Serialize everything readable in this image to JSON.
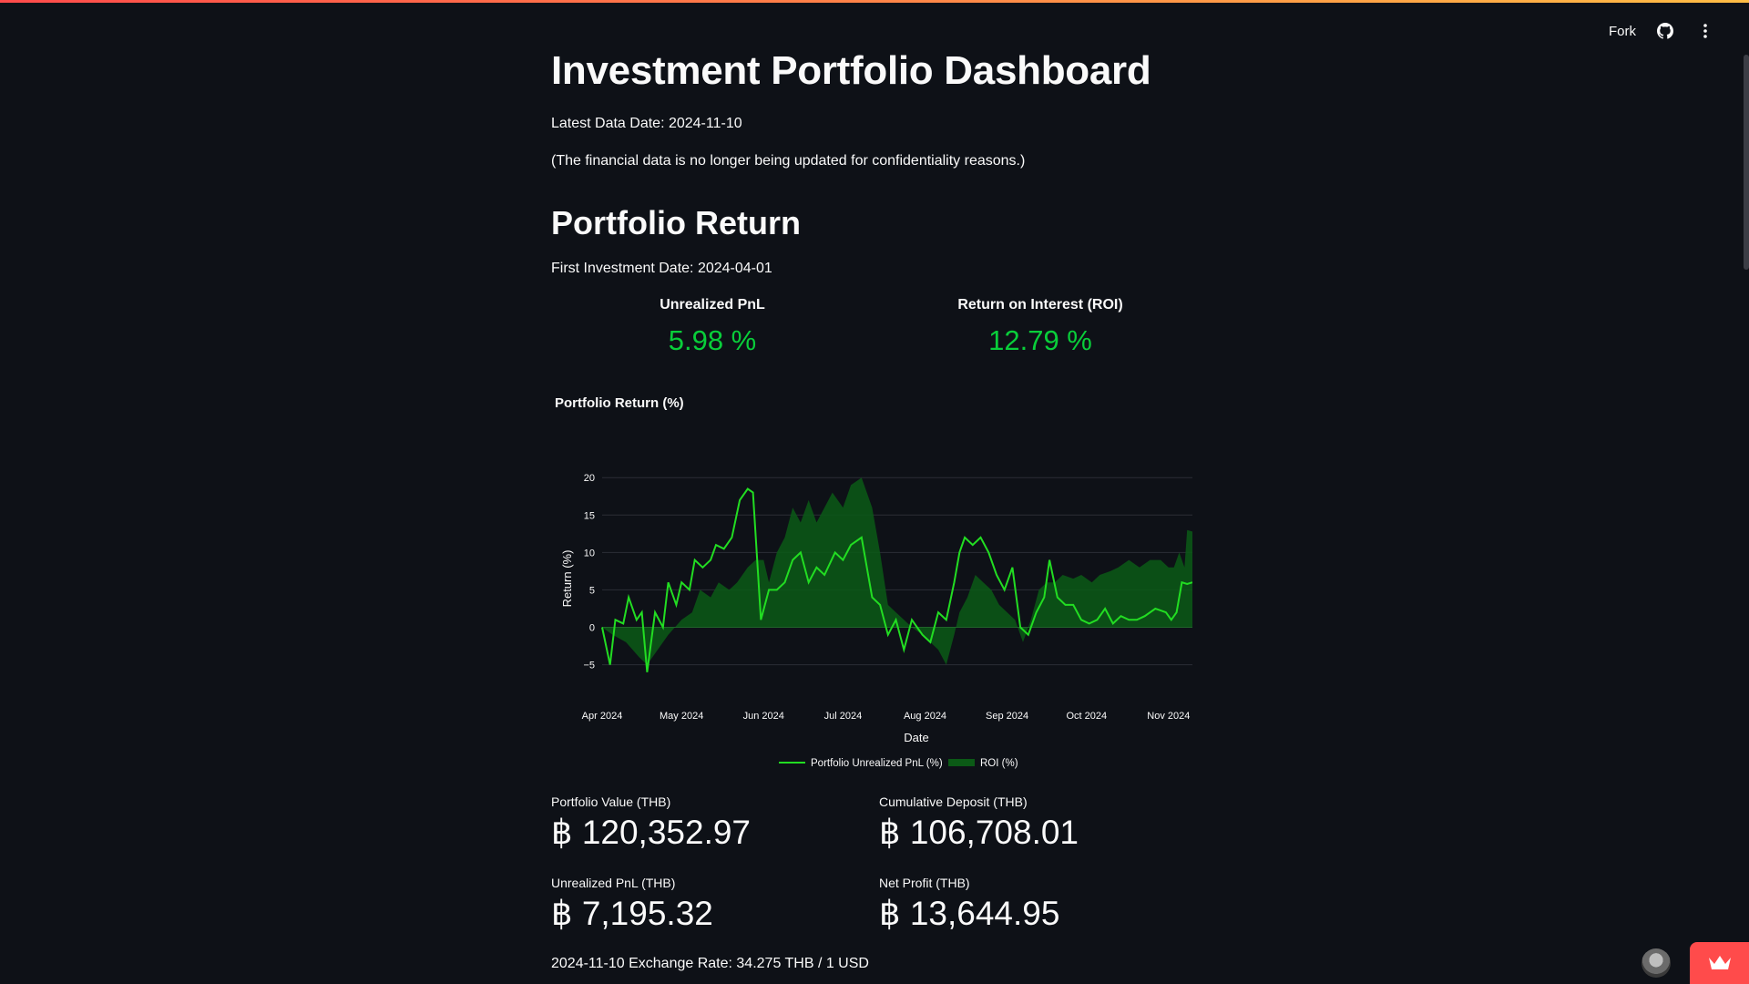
{
  "header": {
    "fork_label": "Fork",
    "github_icon": "github-icon",
    "menu_icon": "vertical-dots-icon"
  },
  "main": {
    "title": "Investment Portfolio Dashboard",
    "latest_date": "Latest Data Date: 2024-11-10",
    "notice": "(The financial data is no longer being updated for confidentiality reasons.)",
    "section_title": "Portfolio Return",
    "first_investment": "First Investment Date: 2024-04-01",
    "kpis": [
      {
        "label": "Unrealized PnL",
        "value": "5.98 %"
      },
      {
        "label": "Return on Interest (ROI)",
        "value": "12.79 %"
      }
    ],
    "metrics": [
      {
        "label": "Portfolio Value (THB)",
        "value": "฿ 120,352.97"
      },
      {
        "label": "Cumulative Deposit (THB)",
        "value": "฿ 106,708.01"
      },
      {
        "label": "Unrealized PnL (THB)",
        "value": "฿ 7,195.32"
      },
      {
        "label": "Net Profit (THB)",
        "value": "฿ 13,644.95"
      }
    ],
    "exchange_rate": "2024-11-10 Exchange Rate: 34.275 THB / 1 USD"
  },
  "colors": {
    "background": "#0e1117",
    "positive": "#09ce3a",
    "pnl_line": "#22dd22",
    "roi_fill": "#0b5a16",
    "accent": "#ff4b4b"
  },
  "chart_data": {
    "type": "line",
    "title": "Portfolio Return (%)",
    "xlabel": "Date",
    "ylabel": "Return (%)",
    "x_ticks": [
      "Apr 2024",
      "May 2024",
      "Jun 2024",
      "Jul 2024",
      "Aug 2024",
      "Sep 2024",
      "Oct 2024",
      "Nov 2024"
    ],
    "y_ticks": [
      "20",
      "15",
      "10",
      "5",
      "0",
      "−5"
    ],
    "ylim": [
      -7,
      21
    ],
    "xlim": [
      "2024-04-01",
      "2024-11-10"
    ],
    "legend_position": "bottom",
    "grid": true,
    "series": [
      {
        "name": "Portfolio Unrealized PnL (%)",
        "style": "line",
        "points": [
          [
            "2024-04-01",
            0
          ],
          [
            "2024-04-04",
            -5
          ],
          [
            "2024-04-06",
            1
          ],
          [
            "2024-04-09",
            0.5
          ],
          [
            "2024-04-11",
            4
          ],
          [
            "2024-04-14",
            1
          ],
          [
            "2024-04-16",
            2
          ],
          [
            "2024-04-18",
            -6
          ],
          [
            "2024-04-21",
            2
          ],
          [
            "2024-04-24",
            0
          ],
          [
            "2024-04-26",
            6
          ],
          [
            "2024-04-29",
            3
          ],
          [
            "2024-05-01",
            6
          ],
          [
            "2024-05-04",
            5
          ],
          [
            "2024-05-06",
            9
          ],
          [
            "2024-05-09",
            8
          ],
          [
            "2024-05-12",
            9
          ],
          [
            "2024-05-14",
            11
          ],
          [
            "2024-05-17",
            10.5
          ],
          [
            "2024-05-20",
            12
          ],
          [
            "2024-05-23",
            17
          ],
          [
            "2024-05-26",
            18.5
          ],
          [
            "2024-05-28",
            18
          ],
          [
            "2024-05-31",
            1
          ],
          [
            "2024-06-03",
            5
          ],
          [
            "2024-06-06",
            5
          ],
          [
            "2024-06-09",
            6
          ],
          [
            "2024-06-12",
            9
          ],
          [
            "2024-06-15",
            10
          ],
          [
            "2024-06-18",
            6
          ],
          [
            "2024-06-21",
            8
          ],
          [
            "2024-06-24",
            7
          ],
          [
            "2024-06-28",
            10
          ],
          [
            "2024-07-01",
            9
          ],
          [
            "2024-07-04",
            11
          ],
          [
            "2024-07-08",
            12
          ],
          [
            "2024-07-12",
            4
          ],
          [
            "2024-07-15",
            3
          ],
          [
            "2024-07-18",
            -1
          ],
          [
            "2024-07-21",
            1
          ],
          [
            "2024-07-24",
            -3
          ],
          [
            "2024-07-27",
            1
          ],
          [
            "2024-07-31",
            -1
          ],
          [
            "2024-08-03",
            -2
          ],
          [
            "2024-08-06",
            2
          ],
          [
            "2024-08-09",
            1
          ],
          [
            "2024-08-12",
            6
          ],
          [
            "2024-08-14",
            10
          ],
          [
            "2024-08-16",
            12
          ],
          [
            "2024-08-19",
            11
          ],
          [
            "2024-08-22",
            12
          ],
          [
            "2024-08-25",
            10
          ],
          [
            "2024-08-28",
            7
          ],
          [
            "2024-08-31",
            5
          ],
          [
            "2024-09-03",
            8
          ],
          [
            "2024-09-06",
            0
          ],
          [
            "2024-09-09",
            -1
          ],
          [
            "2024-09-12",
            2
          ],
          [
            "2024-09-15",
            4
          ],
          [
            "2024-09-17",
            9
          ],
          [
            "2024-09-20",
            4
          ],
          [
            "2024-09-23",
            3
          ],
          [
            "2024-09-26",
            3
          ],
          [
            "2024-09-29",
            1
          ],
          [
            "2024-10-02",
            0.5
          ],
          [
            "2024-10-05",
            1
          ],
          [
            "2024-10-08",
            2.5
          ],
          [
            "2024-10-11",
            0.5
          ],
          [
            "2024-10-14",
            1.5
          ],
          [
            "2024-10-17",
            1
          ],
          [
            "2024-10-20",
            1
          ],
          [
            "2024-10-23",
            1.5
          ],
          [
            "2024-10-27",
            2.5
          ],
          [
            "2024-10-31",
            2
          ],
          [
            "2024-11-02",
            1
          ],
          [
            "2024-11-04",
            2
          ],
          [
            "2024-11-06",
            6
          ],
          [
            "2024-11-08",
            5.8
          ],
          [
            "2024-11-10",
            6
          ]
        ]
      },
      {
        "name": "ROI (%)",
        "style": "area",
        "points": [
          [
            "2024-04-01",
            0
          ],
          [
            "2024-04-05",
            -1
          ],
          [
            "2024-04-10",
            -2
          ],
          [
            "2024-04-15",
            -4
          ],
          [
            "2024-04-18",
            -5
          ],
          [
            "2024-04-22",
            -3
          ],
          [
            "2024-04-26",
            -1
          ],
          [
            "2024-05-01",
            1
          ],
          [
            "2024-05-05",
            2
          ],
          [
            "2024-05-08",
            5
          ],
          [
            "2024-05-12",
            4
          ],
          [
            "2024-05-15",
            6
          ],
          [
            "2024-05-19",
            5
          ],
          [
            "2024-05-22",
            6
          ],
          [
            "2024-05-26",
            8
          ],
          [
            "2024-05-29",
            9
          ],
          [
            "2024-06-01",
            9
          ],
          [
            "2024-06-03",
            6
          ],
          [
            "2024-06-06",
            10
          ],
          [
            "2024-06-09",
            12
          ],
          [
            "2024-06-12",
            16
          ],
          [
            "2024-06-15",
            14
          ],
          [
            "2024-06-18",
            17
          ],
          [
            "2024-06-21",
            14
          ],
          [
            "2024-06-24",
            16
          ],
          [
            "2024-06-27",
            18
          ],
          [
            "2024-07-01",
            16
          ],
          [
            "2024-07-04",
            19
          ],
          [
            "2024-07-08",
            20
          ],
          [
            "2024-07-10",
            18
          ],
          [
            "2024-07-12",
            16
          ],
          [
            "2024-07-15",
            10
          ],
          [
            "2024-07-18",
            3
          ],
          [
            "2024-07-21",
            2
          ],
          [
            "2024-07-24",
            1
          ],
          [
            "2024-07-27",
            0
          ],
          [
            "2024-07-31",
            -1
          ],
          [
            "2024-08-03",
            -2
          ],
          [
            "2024-08-06",
            -3
          ],
          [
            "2024-08-09",
            -5
          ],
          [
            "2024-08-12",
            -1
          ],
          [
            "2024-08-14",
            2
          ],
          [
            "2024-08-17",
            4
          ],
          [
            "2024-08-20",
            7
          ],
          [
            "2024-08-23",
            6
          ],
          [
            "2024-08-26",
            5
          ],
          [
            "2024-08-29",
            3
          ],
          [
            "2024-09-01",
            2
          ],
          [
            "2024-09-04",
            1
          ],
          [
            "2024-09-07",
            -2
          ],
          [
            "2024-09-10",
            1
          ],
          [
            "2024-09-13",
            5
          ],
          [
            "2024-09-16",
            6
          ],
          [
            "2024-09-19",
            6
          ],
          [
            "2024-09-22",
            7
          ],
          [
            "2024-09-26",
            6.5
          ],
          [
            "2024-09-29",
            7
          ],
          [
            "2024-10-03",
            6
          ],
          [
            "2024-10-06",
            7
          ],
          [
            "2024-10-10",
            7.5
          ],
          [
            "2024-10-13",
            8
          ],
          [
            "2024-10-17",
            9
          ],
          [
            "2024-10-21",
            8
          ],
          [
            "2024-10-25",
            9
          ],
          [
            "2024-10-29",
            9
          ],
          [
            "2024-11-01",
            8
          ],
          [
            "2024-11-03",
            8
          ],
          [
            "2024-11-05",
            10
          ],
          [
            "2024-11-07",
            8
          ],
          [
            "2024-11-08",
            13
          ],
          [
            "2024-11-10",
            12.8
          ]
        ]
      }
    ]
  }
}
